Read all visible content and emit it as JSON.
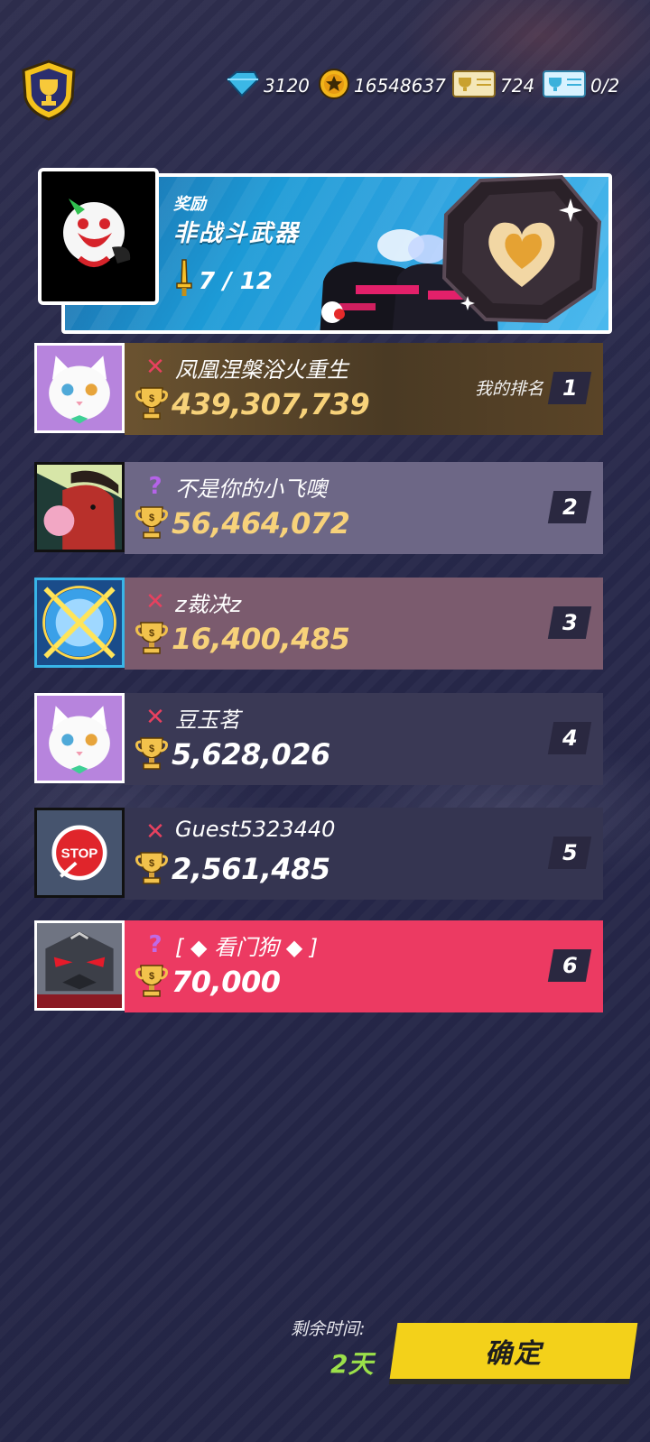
{
  "currencies": {
    "gems": "3120",
    "coins": "16548637",
    "trophy_tickets": "724",
    "special_tickets": "0/2"
  },
  "reward": {
    "title": "奖励",
    "name": "非战斗武器",
    "progress": "7 / 12"
  },
  "leaderboard": [
    {
      "name": "凤凰涅槃浴火重生",
      "score": "439,307,739",
      "rank": "1",
      "status": "✕",
      "status_color": "#e7415f",
      "my_rank_label": "我的排名",
      "panel_color": "#5a4427"
    },
    {
      "name": "不是你的小飞噢",
      "score": "56,464,072",
      "rank": "2",
      "status": "?",
      "status_color": "#b563e8",
      "panel_color": "#6d6786"
    },
    {
      "name": "z裁决z",
      "score": "16,400,485",
      "rank": "3",
      "status": "✕",
      "status_color": "#e7415f",
      "panel_color": "#7b5b6e"
    },
    {
      "name": "豆玉茗",
      "score": "5,628,026",
      "rank": "4",
      "status": "✕",
      "status_color": "#e7415f",
      "panel_color": "#3a3955"
    },
    {
      "name": "Guest5323440",
      "score": "2,561,485",
      "rank": "5",
      "status": "✕",
      "status_color": "#e7415f",
      "panel_color": "#353551"
    },
    {
      "name": "[ ◆ 看门狗 ◆ ]",
      "score": "70,000",
      "rank": "6",
      "status": "?",
      "status_color": "#c06ae6",
      "panel_color": "#ec3a62"
    }
  ],
  "footer": {
    "time_label": "剩余时间:",
    "time_value": "2天",
    "confirm_label": "确定"
  }
}
